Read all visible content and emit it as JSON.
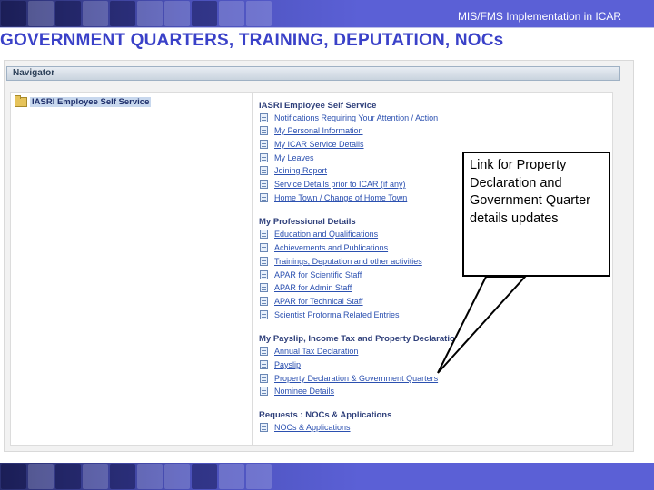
{
  "banner": {
    "title": "MIS/FMS Implementation in ICAR"
  },
  "slide": {
    "title": "GOVERNMENT QUARTERS, TRAINING, DEPUTATION, NOCs"
  },
  "navigator": {
    "header": "Navigator",
    "root_item": "IASRI Employee Self Service"
  },
  "content": {
    "sections": [
      {
        "title": "IASRI Employee Self Service",
        "links": [
          "Notifications Requiring Your Attention / Action",
          "My Personal Information",
          "My ICAR Service Details",
          "My Leaves",
          "Joining Report",
          "Service Details prior to ICAR (if any)",
          "Home Town / Change of Home Town"
        ]
      },
      {
        "title": "My Professional Details",
        "links": [
          "Education and Qualifications",
          "Achievements and Publications",
          "Trainings, Deputation and other activities",
          "APAR for Scientific Staff",
          "APAR for Admin Staff",
          "APAR for Technical Staff",
          "Scientist Proforma Related Entries"
        ]
      },
      {
        "title": "My Payslip, Income Tax and Property Declaration",
        "links": [
          "Annual Tax Declaration",
          "Payslip",
          "Property Declaration & Government Quarters",
          "Nominee Details"
        ]
      },
      {
        "title": "Requests : NOCs & Applications",
        "links": [
          "NOCs & Applications"
        ]
      }
    ]
  },
  "callout": {
    "text": "Link for Property Declaration and Government Quarter details updates"
  },
  "colors": {
    "banner": "#5b60d6",
    "slide_title": "#3a41c8",
    "link": "#2b50b0",
    "section": "#2e3f7a"
  }
}
